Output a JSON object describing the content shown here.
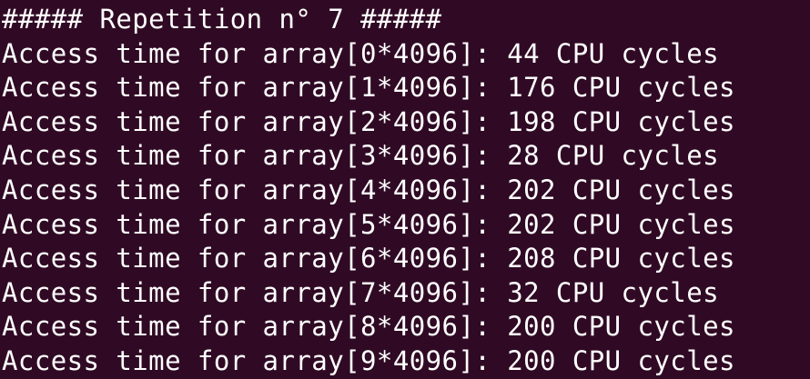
{
  "terminal": {
    "header": "##### Repetition n° 7 #####",
    "lines": [
      "Access time for array[0*4096]: 44 CPU cycles",
      "Access time for array[1*4096]: 176 CPU cycles",
      "Access time for array[2*4096]: 198 CPU cycles",
      "Access time for array[3*4096]: 28 CPU cycles",
      "Access time for array[4*4096]: 202 CPU cycles",
      "Access time for array[5*4096]: 202 CPU cycles",
      "Access time for array[6*4096]: 208 CPU cycles",
      "Access time for array[7*4096]: 32 CPU cycles",
      "Access time for array[8*4096]: 200 CPU cycles",
      "Access time for array[9*4096]: 200 CPU cycles"
    ]
  },
  "colors": {
    "background": "#300a24",
    "foreground": "#ffffff"
  }
}
